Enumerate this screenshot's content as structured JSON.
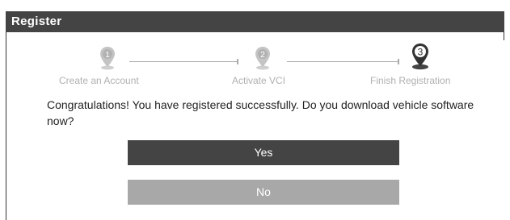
{
  "dialog": {
    "title": "Register"
  },
  "steps": [
    {
      "number": "1",
      "label": "Create an Account",
      "state": "inactive"
    },
    {
      "number": "2",
      "label": "Activate VCI",
      "state": "inactive"
    },
    {
      "number": "3",
      "label": "Finish Registration",
      "state": "active"
    }
  ],
  "message": "Congratulations! You have registered successfully. Do you download vehicle software now?",
  "buttons": {
    "yes_label": "Yes",
    "no_label": "No"
  },
  "colors": {
    "title_bar": "#444444",
    "yes_button": "#444444",
    "no_button": "#a8a8a8",
    "inactive_step": "#b0b0b0",
    "active_step": "#333333"
  },
  "icons": {
    "step_marker": "map-pin-icon"
  }
}
